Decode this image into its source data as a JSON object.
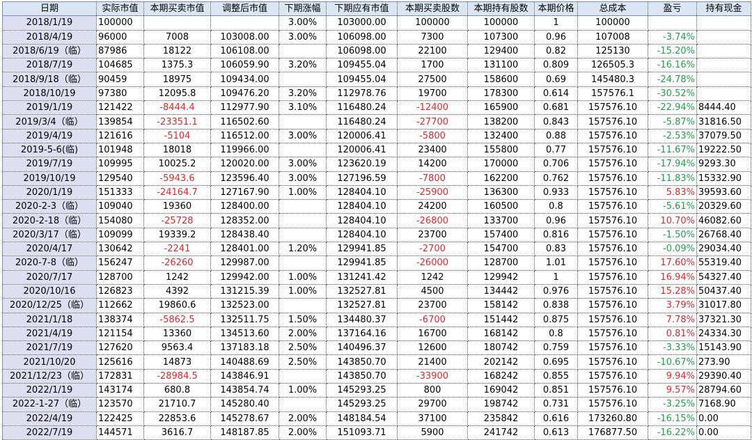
{
  "headers": [
    "日期",
    "实际市值",
    "本期买卖市值",
    "调整后市值",
    "下期涨幅",
    "下期应有市值",
    "本期买卖股数",
    "本期持有股数",
    "本期价格",
    "总成本",
    "盈亏",
    "持有现金"
  ],
  "colors": {
    "negative": "#e8262a",
    "positive": "#1fa24a",
    "header_bg": "#dbe6f5",
    "date_bg": "#dcdff0"
  },
  "rows": [
    [
      "2018/1/19",
      "100000",
      "",
      "",
      "3.00%",
      "103000.00",
      "100000",
      "100000",
      "1",
      "100000",
      "",
      ""
    ],
    [
      "2018/4/19",
      "96000",
      "7008",
      "103008.00",
      "3.00%",
      "106098.00",
      "7300",
      "107300",
      "0.96",
      "107008",
      "-3.74%",
      ""
    ],
    [
      "2018/6/19（临）",
      "87986",
      "18122",
      "106108.00",
      "",
      "106098.00",
      "22100",
      "129400",
      "0.82",
      "125130",
      "-15.20%",
      ""
    ],
    [
      "2018/7/19",
      "104685",
      "1375.3",
      "106059.90",
      "3.20%",
      "109455.04",
      "1700",
      "131100",
      "0.809",
      "126505.3",
      "-16.16%",
      ""
    ],
    [
      "2018/9/18（临）",
      "90459",
      "18975",
      "109434.00",
      "",
      "109455.04",
      "27500",
      "158600",
      "0.69",
      "145480.3",
      "-24.78%",
      ""
    ],
    [
      "2018/10/19",
      "97380",
      "12095.8",
      "109476.20",
      "3.20%",
      "112978.76",
      "19700",
      "178300",
      "0.614",
      "157576.1",
      "-30.52%",
      ""
    ],
    [
      "2019/1/19",
      "121422",
      "-8444.4",
      "112977.90",
      "3.10%",
      "116480.24",
      "-12400",
      "165900",
      "0.681",
      "157576.10",
      "-22.94%",
      "8444.40"
    ],
    [
      "2019/3/4（临）",
      "139854",
      "-23351.1",
      "116502.60",
      "",
      "116480.24",
      "-27700",
      "138200",
      "0.843",
      "157576.10",
      "-5.87%",
      "31816.50"
    ],
    [
      "2019/4/19",
      "121616",
      "-5104",
      "116512.00",
      "3.00%",
      "120006.41",
      "-5800",
      "132400",
      "0.88",
      "157576.10",
      "-2.53%",
      "37079.50"
    ],
    [
      "2019-5-6(临)",
      "101948",
      "18018",
      "119966.00",
      "",
      "120006.41",
      "23400",
      "155800",
      "0.77",
      "157576.10",
      "-11.67%",
      "19222.50"
    ],
    [
      "2019/7/19",
      "109995",
      "10025.2",
      "120020.00",
      "3.00%",
      "123620.19",
      "14200",
      "170000",
      "0.706",
      "157576.10",
      "-17.94%",
      "9293.30"
    ],
    [
      "2019/10/19",
      "129540",
      "-5943.6",
      "123596.40",
      "3.00%",
      "127196.59",
      "-7800",
      "162200",
      "0.762",
      "157576.10",
      "-11.83%",
      "15332.90"
    ],
    [
      "2020/1/19",
      "151333",
      "-24164.7",
      "127167.90",
      "1.00%",
      "128404.10",
      "-25900",
      "136300",
      "0.933",
      "157576.10",
      "5.83%",
      "39593.60"
    ],
    [
      "2020-2-3（临）",
      "109040",
      "19360",
      "128400.00",
      "",
      "128404.10",
      "24200",
      "160500",
      "0.8",
      "157576.10",
      "-5.61%",
      "20329.60"
    ],
    [
      "2020-2-18（临）",
      "154080",
      "-25728",
      "128352.00",
      "",
      "128404.10",
      "-26800",
      "133700",
      "0.96",
      "157576.10",
      "10.70%",
      "46082.60"
    ],
    [
      "2020/3/17（临）",
      "109099",
      "19339.2",
      "128438.40",
      "",
      "128404.10",
      "23700",
      "157400",
      "0.816",
      "157576.10",
      "-1.50%",
      "26768.40"
    ],
    [
      "2020/4/17",
      "130642",
      "-2241",
      "128401.00",
      "1.20%",
      "129941.85",
      "-2700",
      "154700",
      "0.83",
      "157576.10",
      "-0.09%",
      "29034.40"
    ],
    [
      "2020-7-8（临）",
      "156247",
      "-26260",
      "129987.00",
      "",
      "129941.85",
      "-26000",
      "128700",
      "1.01",
      "157576.10",
      "17.60%",
      "55319.40"
    ],
    [
      "2020/7/17",
      "128700",
      "1242",
      "129942.00",
      "1.00%",
      "131241.42",
      "1242",
      "129942",
      "1",
      "157576.10",
      "16.94%",
      "54327.40"
    ],
    [
      "2020/10/16",
      "126823",
      "4392",
      "131215.39",
      "1.00%",
      "132527.81",
      "4500",
      "134442",
      "0.976",
      "157576.10",
      "15.28%",
      "50437.40"
    ],
    [
      "2020/12/25（临）",
      "112662",
      "19860.6",
      "132523.00",
      "",
      "132527.81",
      "23700",
      "158142",
      "0.838",
      "157576.10",
      "3.79%",
      "31017.80"
    ],
    [
      "2021/1/18",
      "138374",
      "-5862.5",
      "132511.75",
      "1.50%",
      "134480.37",
      "-6700",
      "151442",
      "0.875",
      "157576.10",
      "7.78%",
      "37321.30"
    ],
    [
      "2021/4/19",
      "121154",
      "13360",
      "134513.60",
      "2.00%",
      "137164.16",
      "16700",
      "168142",
      "0.8",
      "157576.10",
      "0.81%",
      "24334.30"
    ],
    [
      "2021/7/19",
      "127620",
      "9563.4",
      "137183.18",
      "2.50%",
      "140496.37",
      "12600",
      "180742",
      "0.759",
      "157576.10",
      "-3.33%",
      "15143.90"
    ],
    [
      "2021/10/20",
      "125616",
      "14873",
      "140488.69",
      "2.50%",
      "143850.70",
      "21400",
      "202142",
      "0.695",
      "157576.10",
      "-10.67%",
      "273.90"
    ],
    [
      "2021/12/23（临）",
      "172831",
      "-28984.5",
      "143846.91",
      "",
      "143850.70",
      "-33900",
      "168242",
      "0.855",
      "157576.10",
      "9.94%",
      "29390.40"
    ],
    [
      "2022/1/19",
      "143174",
      "680.8",
      "143854.74",
      "1.00%",
      "145293.25",
      "800",
      "169042",
      "0.851",
      "157576.10",
      "9.57%",
      "28794.60"
    ],
    [
      "2022-1-27（临）",
      "123570",
      "21710.7",
      "145280.40",
      "",
      "145293.25",
      "29700",
      "198742",
      "0.731",
      "157576.10",
      "-3.25%",
      "7168.90"
    ],
    [
      "2022/4/19",
      "122425",
      "22853.6",
      "145278.67",
      "2.00%",
      "148184.54",
      "37100",
      "235842",
      "0.616",
      "173260.80",
      "-16.15%",
      "0.00"
    ],
    [
      "2022/7/19",
      "144571",
      "3616.7",
      "148187.85",
      "2.00%",
      "151093.71",
      "5900",
      "241742",
      "0.613",
      "176877.50",
      "-16.22%",
      "0.00"
    ]
  ]
}
